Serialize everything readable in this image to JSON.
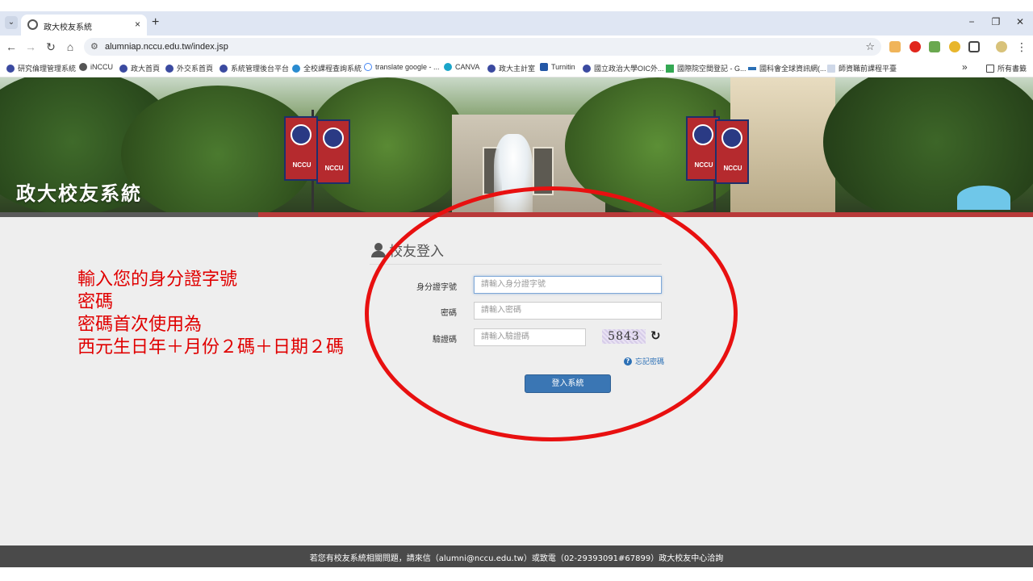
{
  "browser": {
    "tab_title": "政大校友系統",
    "tab_close": "×",
    "new_tab": "+",
    "url": "alumniap.nccu.edu.tw/index.jsp",
    "window_controls": {
      "minimize": "−",
      "restore": "❐",
      "close": "✕"
    },
    "nav": {
      "back": "←",
      "forward": "→",
      "reload": "↻",
      "home": "⌂"
    },
    "bookmarks": [
      "研究倫理管理系統",
      "iNCCU",
      "政大首頁",
      "外交系首頁",
      "系統管理後台平台",
      "全校課程查詢系統",
      "translate google - ...",
      "CANVA",
      "政大主計室",
      "Turnitin",
      "國立政治大學OIC外...",
      "國際院空間登記 - G...",
      "國科會全球資訊網(...",
      "師資職前課程平臺"
    ],
    "bookmarks_more": "»",
    "all_bookmarks": "所有書籤"
  },
  "banner": {
    "title": "政大校友系統",
    "flag_text": "NCCU"
  },
  "login": {
    "heading": "校友登入",
    "fields": [
      {
        "label": "身分證字號",
        "placeholder": "請輸入身分證字號"
      },
      {
        "label": "密碼",
        "placeholder": "請輸入密碼"
      },
      {
        "label": "驗證碼",
        "placeholder": "請輸入驗證碼"
      }
    ],
    "captcha_text": "5843",
    "refresh_icon": "↻",
    "forgot_password": "忘記密碼",
    "forgot_icon": "?",
    "submit_label": "登入系統"
  },
  "annotation": {
    "lines": [
      "輸入您的身分證字號",
      "密碼",
      "密碼首次使用為",
      "西元生日年＋月份２碼＋日期２碼"
    ],
    "color": "#e00000"
  },
  "footer": {
    "text": "若您有校友系統相關問題，請來信（alumni@nccu.edu.tw）或致電（02-29393091#67899）政大校友中心洽詢"
  }
}
